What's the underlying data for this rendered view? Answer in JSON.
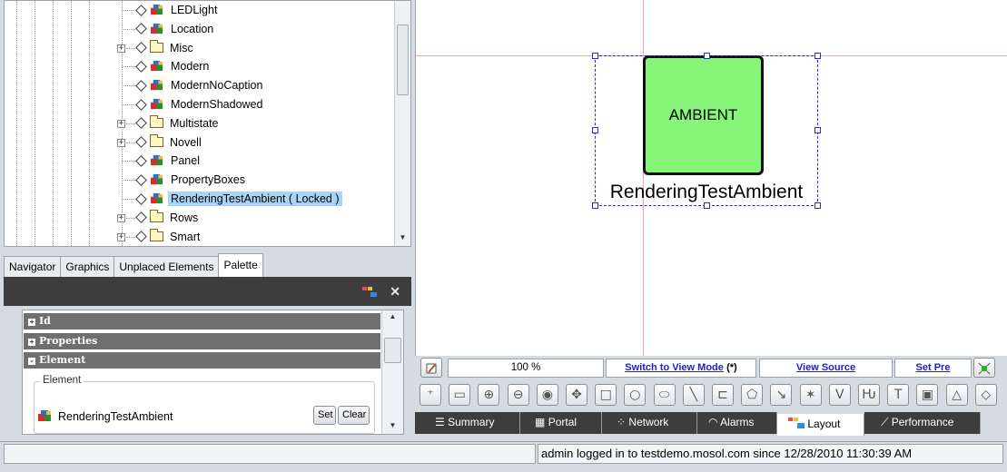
{
  "tree": {
    "items": [
      {
        "label": "LEDLight",
        "type": "widget",
        "expandable": false
      },
      {
        "label": "Location",
        "type": "widget",
        "expandable": false
      },
      {
        "label": "Misc",
        "type": "folder",
        "expandable": true
      },
      {
        "label": "Modern",
        "type": "widget",
        "expandable": false
      },
      {
        "label": "ModernNoCaption",
        "type": "widget",
        "expandable": false
      },
      {
        "label": "ModernShadowed",
        "type": "widget",
        "expandable": false
      },
      {
        "label": "Multistate",
        "type": "folder",
        "expandable": true
      },
      {
        "label": "Novell",
        "type": "folder",
        "expandable": true
      },
      {
        "label": "Panel",
        "type": "widget",
        "expandable": false
      },
      {
        "label": "PropertyBoxes",
        "type": "widget",
        "expandable": false
      },
      {
        "label": "RenderingTestAmbient ( Locked )",
        "type": "widget",
        "expandable": false,
        "selected": true
      },
      {
        "label": "Rows",
        "type": "folder",
        "expandable": true
      },
      {
        "label": "Smart",
        "type": "folder",
        "expandable": true
      }
    ]
  },
  "tabs": [
    "Navigator",
    "Graphics",
    "Unplaced Elements",
    "Palette"
  ],
  "active_tab": "Palette",
  "palette": {
    "sections": [
      {
        "label": "Id",
        "state": "+"
      },
      {
        "label": "Properties",
        "state": "+"
      },
      {
        "label": "Element",
        "state": "-"
      }
    ],
    "element_legend": "Element",
    "element_value": "RenderingTestAmbient",
    "set_label": "Set",
    "clear_label": "Clear"
  },
  "canvas": {
    "widget_text": "AMBIENT",
    "caption": "RenderingTestAmbient",
    "widget_color": "#86f57a"
  },
  "toolbar": {
    "zoom": "100 %",
    "switch_mode": "Switch to View Mode",
    "switch_mode_suffix": "(*)",
    "view_source": "View Source",
    "set_pre": "Set Pre"
  },
  "bottom_tabs": [
    "Summary",
    "Portal",
    "Network",
    "Alarms",
    "Layout",
    "Performance"
  ],
  "active_bottom_tab": "Layout",
  "status": {
    "message": "admin logged in to testdemo.mosol.com since 12/28/2010 11:30:39 AM"
  }
}
